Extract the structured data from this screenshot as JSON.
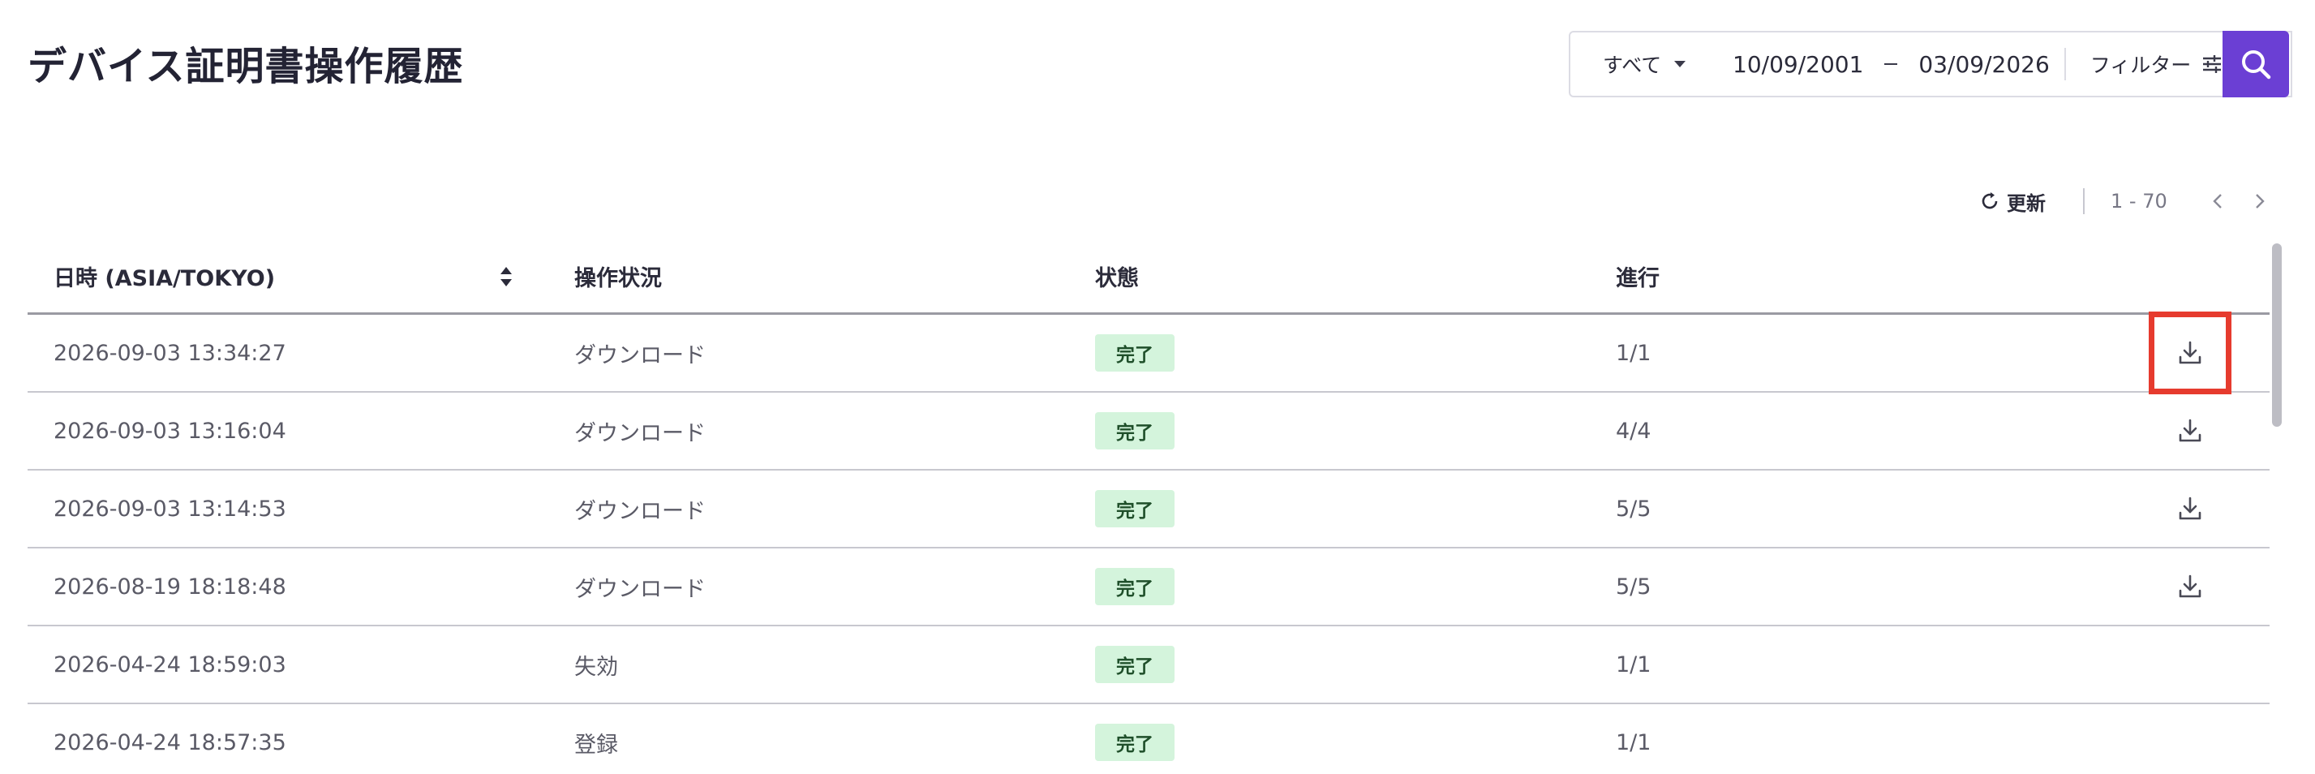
{
  "page": {
    "title": "デバイス証明書操作履歴"
  },
  "filter": {
    "scope_value": "すべて",
    "date_from": "10/09/2001",
    "date_to": "03/09/2026",
    "filter_label": "フィルター"
  },
  "toolbar": {
    "refresh_label": "更新",
    "page_range": "1 - 70"
  },
  "table": {
    "headers": {
      "datetime": "日時 (ASIA/TOKYO)",
      "operation": "操作状況",
      "status": "状態",
      "progress": "進行"
    },
    "rows": [
      {
        "datetime": "2026-09-03 13:34:27",
        "operation": "ダウンロード",
        "status": "完了",
        "progress": "1/1",
        "downloadable": true
      },
      {
        "datetime": "2026-09-03 13:16:04",
        "operation": "ダウンロード",
        "status": "完了",
        "progress": "4/4",
        "downloadable": true
      },
      {
        "datetime": "2026-09-03 13:14:53",
        "operation": "ダウンロード",
        "status": "完了",
        "progress": "5/5",
        "downloadable": true
      },
      {
        "datetime": "2026-08-19 18:18:48",
        "operation": "ダウンロード",
        "status": "完了",
        "progress": "5/5",
        "downloadable": true
      },
      {
        "datetime": "2026-04-24 18:59:03",
        "operation": "失効",
        "status": "完了",
        "progress": "1/1",
        "downloadable": false
      },
      {
        "datetime": "2026-04-24 18:57:35",
        "operation": "登録",
        "status": "完了",
        "progress": "1/1",
        "downloadable": false
      }
    ]
  },
  "icons": {
    "scope_caret": "caret-down-icon",
    "filter": "sliders-icon",
    "search": "search-icon",
    "refresh": "refresh-icon",
    "prev": "chevron-left-icon",
    "next": "chevron-right-icon",
    "sort": "sort-icon",
    "download": "download-icon"
  },
  "colors": {
    "accent": "#6b3fd4",
    "status_badge_bg": "#d4f4dc",
    "highlight": "#e63b2e"
  }
}
